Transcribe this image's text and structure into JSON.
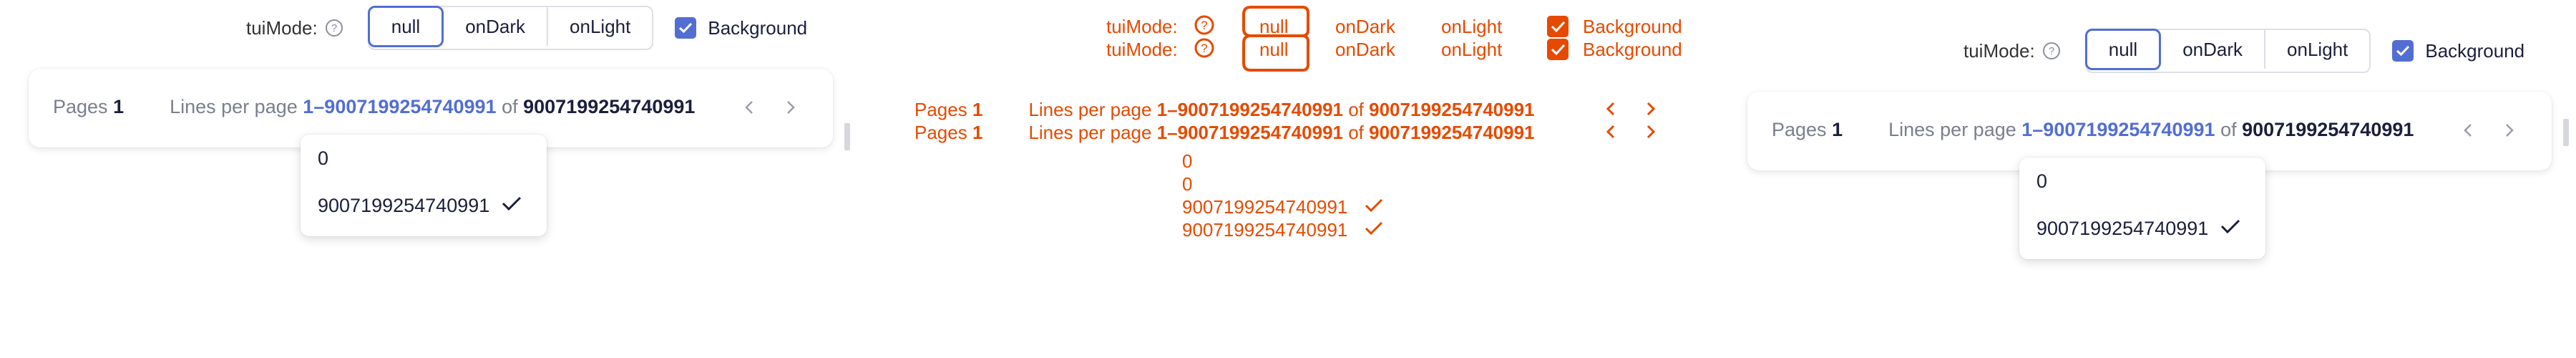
{
  "mode_label": "tuiMode:",
  "modes": [
    "null",
    "onDark",
    "onLight"
  ],
  "active_mode": "null",
  "background_label": "Background",
  "pagination": {
    "pages_label": "Pages",
    "pages_value": "1",
    "lines_label": "Lines per page",
    "range": "1–9007199254740991",
    "of_label": "of",
    "total": "9007199254740991"
  },
  "dropdown": {
    "options": [
      "0",
      "9007199254740991"
    ],
    "selected": "9007199254740991"
  },
  "colors": {
    "accent": "#526ed3",
    "diff": "#e64a00",
    "text": "#1b1f3b",
    "muted": "#7b7f8d"
  },
  "icons": {
    "help": "help-icon",
    "checkbox": "check-icon",
    "prev": "chevron-left-icon",
    "next": "chevron-right-icon",
    "selected": "check-icon"
  }
}
